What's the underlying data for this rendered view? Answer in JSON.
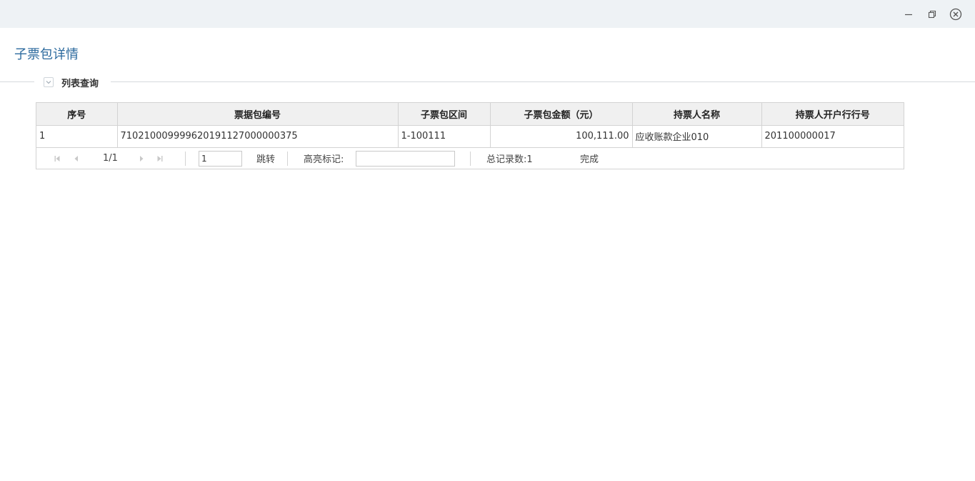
{
  "page": {
    "title": "子票包详情"
  },
  "section": {
    "label": "列表查询"
  },
  "table": {
    "columns": [
      "序号",
      "票据包编号",
      "子票包区间",
      "子票包金额（元）",
      "持票人名称",
      "持票人开户行行号"
    ],
    "rows": [
      [
        "1",
        "710210009999620191127000000375",
        "1-100111",
        "100,111.00",
        "应收账款企业010",
        "201100000017"
      ]
    ]
  },
  "pager": {
    "page_info": "1/1",
    "page_input": "1",
    "jump_label": "跳转",
    "highlight_label": "高亮标记:",
    "highlight_value": "",
    "total_label": "总记录数:1",
    "status": "完成"
  }
}
